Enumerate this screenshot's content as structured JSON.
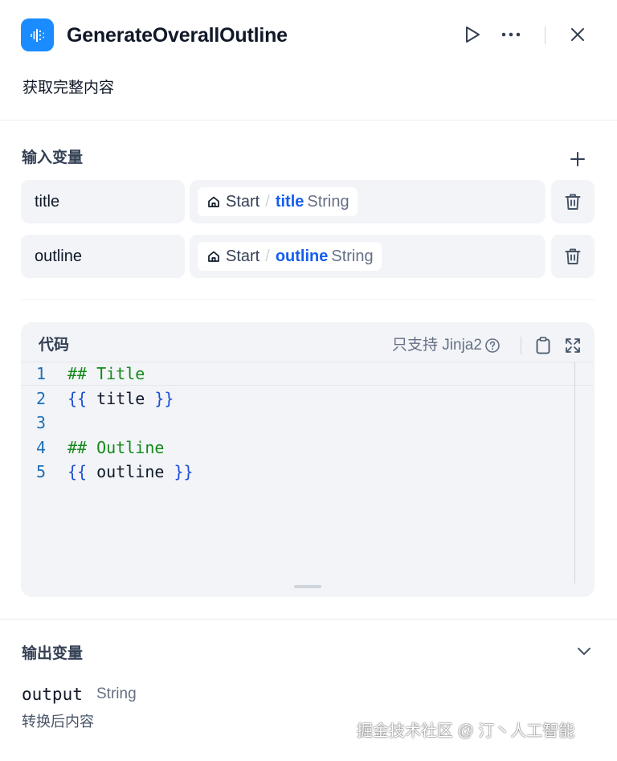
{
  "node": {
    "title": "GenerateOverallOutline",
    "description": "获取完整内容",
    "icon": "code-node-icon"
  },
  "header_actions": [
    "run-icon",
    "more-icon",
    "close-icon"
  ],
  "input_section": {
    "title": "输入变量",
    "add_icon": "plus-icon",
    "variables": [
      {
        "name": "title",
        "ref_node": "Start",
        "ref_var": "title",
        "ref_type": "String"
      },
      {
        "name": "outline",
        "ref_node": "Start",
        "ref_var": "outline",
        "ref_type": "String"
      }
    ],
    "separator": "/"
  },
  "code_section": {
    "label": "代码",
    "support_text": "只支持 Jinja2",
    "lines": [
      {
        "no": "1",
        "parts": [
          {
            "t": "## Title",
            "k": "heading"
          }
        ]
      },
      {
        "no": "2",
        "parts": [
          {
            "t": "{{",
            "k": "brace"
          },
          {
            "t": " title ",
            "k": "var"
          },
          {
            "t": "}}",
            "k": "brace"
          }
        ]
      },
      {
        "no": "3",
        "parts": []
      },
      {
        "no": "4",
        "parts": [
          {
            "t": "## Outline",
            "k": "heading"
          }
        ]
      },
      {
        "no": "5",
        "parts": [
          {
            "t": "{{",
            "k": "brace"
          },
          {
            "t": " outline ",
            "k": "var"
          },
          {
            "t": "}}",
            "k": "brace"
          }
        ]
      }
    ]
  },
  "output_section": {
    "title": "输出变量",
    "variable": {
      "name": "output",
      "type": "String",
      "description": "转换后内容"
    }
  },
  "watermark": "掘金技术社区 @ 汀丶人工智能",
  "colors": {
    "accent": "#155eef",
    "icon_bg": "#1a8cff",
    "panel_bg": "#f2f4f7"
  }
}
